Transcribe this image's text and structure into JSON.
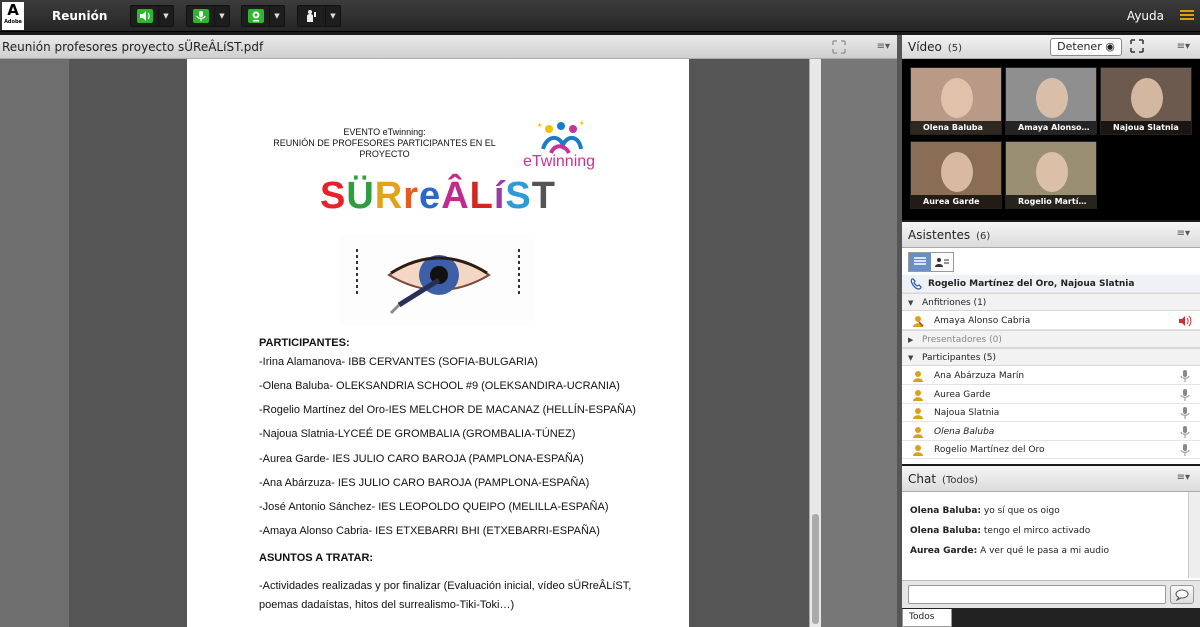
{
  "topbar": {
    "logo_text": "Adobe",
    "meeting_label": "Reunión",
    "help_label": "Ayuda"
  },
  "share": {
    "title": "Reunión profesores proyecto sÜReÂLíST.pdf",
    "document": {
      "event_line1": "EVENTO eTwinning:",
      "event_line2": "REUNIÓN DE PROFESORES PARTICIPANTES EN EL",
      "event_line3": "PROYECTO",
      "etwinning_logo": "eTwinning",
      "project_letters": [
        {
          "ch": "S",
          "color": "#e8202a"
        },
        {
          "ch": "Ü",
          "color": "#2e9e3e"
        },
        {
          "ch": "R",
          "color": "#e3a316"
        },
        {
          "ch": "r",
          "color": "#e65a1e"
        },
        {
          "ch": "e",
          "color": "#2a68c9"
        },
        {
          "ch": "Â",
          "color": "#c22a8c"
        },
        {
          "ch": "L",
          "color": "#d4251f"
        },
        {
          "ch": "í",
          "color": "#9a3aa8"
        },
        {
          "ch": "S",
          "color": "#2d9bd6"
        },
        {
          "ch": "T",
          "color": "#555555"
        }
      ],
      "participants_heading": "PARTICIPANTES:",
      "participants": [
        "-Irina Alamanova- IBB CERVANTES (SOFIA-BULGARIA)",
        "-Olena Baluba- OLEKSANDRIA SCHOOL #9 (OLEKSANDIRA-UCRANIA)",
        "-Rogelio Martínez del Oro-IES MELCHOR DE MACANAZ (HELLÍN-ESPAÑA)",
        "-Najoua Slatnia-LYCEÉ DE GROMBALIA (GROMBALIA-TÚNEZ)",
        "-Aurea Garde- IES JULIO CARO BAROJA (PAMPLONA-ESPAÑA)",
        "-Ana Abárzuza- IES JULIO CARO BAROJA (PAMPLONA-ESPAÑA)",
        "-José Antonio Sánchez- IES LEOPOLDO QUEIPO (MELILLA-ESPAÑA)",
        "-Amaya Alonso Cabria- IES ETXEBARRI BHI (ETXEBARRI-ESPAÑA)"
      ],
      "topics_heading": "ASUNTOS A TRATAR:",
      "topics_line1": "-Actividades realizadas y por finalizar (Evaluación inicial, vídeo sÜRreÂLíST,",
      "topics_line2": "poemas dadaístas, hitos del surrealismo-Tiki-Toki…)"
    }
  },
  "video": {
    "title": "Vídeo",
    "count": "(5)",
    "stop_label": "Detener",
    "tiles": [
      {
        "name": "Olena Baluba",
        "color": "#b89a86"
      },
      {
        "name": "Amaya Alonso…",
        "color": "#8f8f8f"
      },
      {
        "name": "Najoua Slatnia",
        "color": "#6d5a4e"
      },
      {
        "name": "Aurea Garde",
        "color": "#8a6d55"
      },
      {
        "name": "Rogelio Martí…",
        "color": "#9a8f73"
      }
    ]
  },
  "attendees": {
    "title": "Asistentes",
    "count": "(6)",
    "phone_line": "Rogelio Martínez del Oro, Najoua Slatnia",
    "hosts_label": "Anfitriones (1)",
    "hosts": [
      "Amaya Alonso Cabria"
    ],
    "presenters_label": "Presentadores (0)",
    "participants_label": "Participantes (5)",
    "participants": [
      {
        "name": "Ana Abárzuza Marín",
        "italic": false
      },
      {
        "name": "Aurea Garde",
        "italic": false
      },
      {
        "name": "Najoua Slatnia",
        "italic": false
      },
      {
        "name": "Olena Baluba",
        "italic": true
      },
      {
        "name": "Rogelio Martínez del Oro",
        "italic": false
      }
    ]
  },
  "chat": {
    "title": "Chat",
    "scope": "(Todos)",
    "messages": [
      {
        "sender": "Olena Baluba",
        "text": "yo sí que os oigo"
      },
      {
        "sender": "Olena Baluba",
        "text": "tengo el mirco activado"
      },
      {
        "sender": "Aurea Garde",
        "text": "A ver qué le pasa a mi audio"
      }
    ],
    "input_value": "",
    "tab_label": "Todos"
  },
  "colors": {
    "accent_green": "#2fb52f",
    "speaker_red": "#d03030"
  }
}
